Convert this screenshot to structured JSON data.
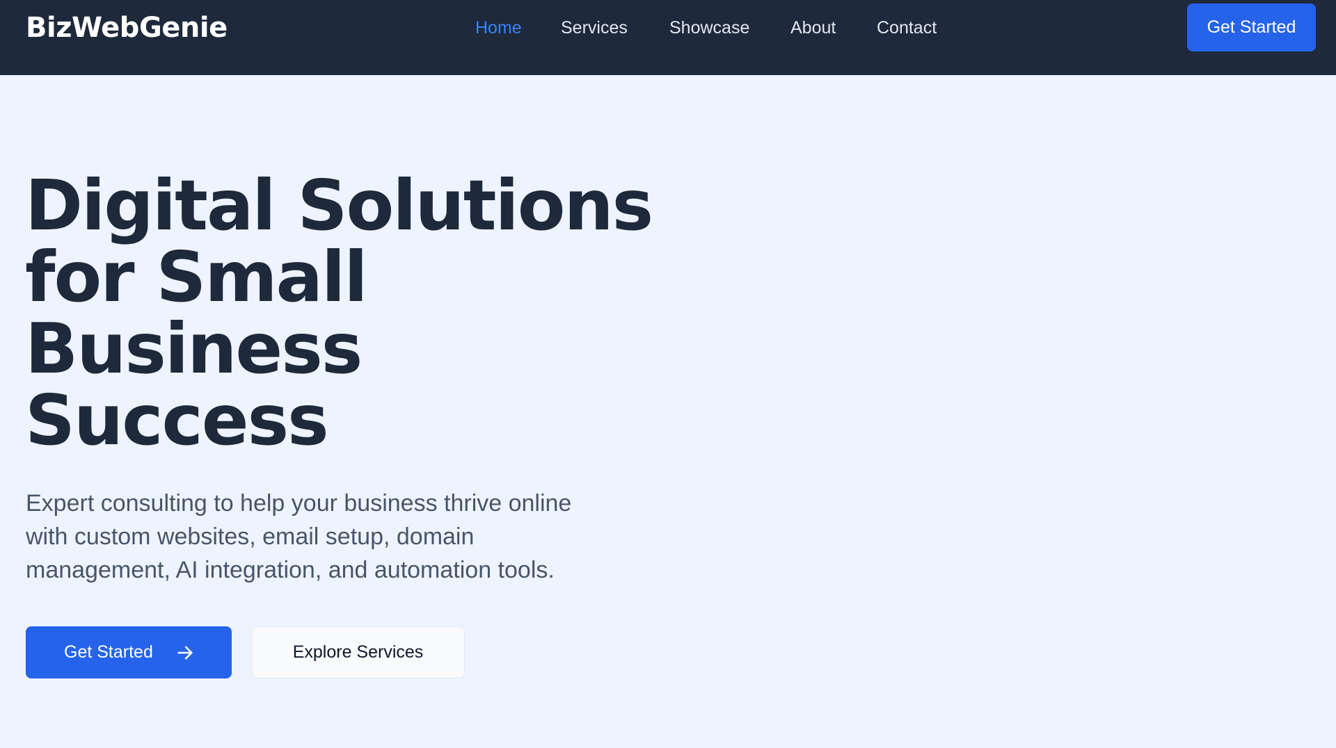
{
  "brand": {
    "name": "BizWebGenie"
  },
  "nav": {
    "items": [
      {
        "label": "Home"
      },
      {
        "label": "Services"
      },
      {
        "label": "Showcase"
      },
      {
        "label": "About"
      },
      {
        "label": "Contact"
      }
    ],
    "active": "Home",
    "cta_label": "Get Started"
  },
  "hero": {
    "title_lines": [
      "Digital Solutions",
      "for Small",
      "Business",
      "Success"
    ],
    "subtitle_lines": [
      "Expert consulting to help your business thrive online",
      "with custom websites, email setup, domain",
      "management, AI integration, and automation tools."
    ],
    "primary_button": {
      "label": "Get Started",
      "icon": "arrow-right-icon"
    },
    "secondary_button": {
      "label": "Explore Services"
    }
  },
  "colors": {
    "nav_background": "#1e293b",
    "page_background": "#eef4ff",
    "accent": "#2563eb",
    "active_link": "#3b82f6",
    "heading": "#1e293b",
    "body_text": "#475569"
  }
}
